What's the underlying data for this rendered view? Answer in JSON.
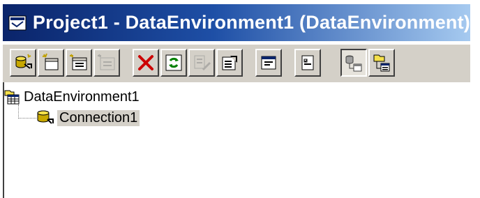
{
  "window": {
    "title": "Project1 - DataEnvironment1 (DataEnvironment)",
    "title_icon": "data-environment-window-icon"
  },
  "toolbar": {
    "buttons": [
      {
        "icon": "add-connection-icon",
        "state": "enabled"
      },
      {
        "icon": "add-command-icon",
        "state": "enabled"
      },
      {
        "icon": "add-child-command-icon",
        "state": "enabled"
      },
      {
        "icon": "insert-stored-procedures-icon",
        "state": "disabled"
      },
      {
        "icon": "delete-icon",
        "state": "enabled"
      },
      {
        "icon": "refresh-icon",
        "state": "enabled"
      },
      {
        "icon": "design-icon",
        "state": "disabled"
      },
      {
        "icon": "properties-icon",
        "state": "enabled"
      },
      {
        "icon": "view-code-icon",
        "state": "enabled"
      },
      {
        "icon": "options-icon",
        "state": "enabled"
      },
      {
        "icon": "arrange-by-connections-icon",
        "state": "pressed"
      },
      {
        "icon": "arrange-by-objects-icon",
        "state": "enabled"
      }
    ]
  },
  "tree": {
    "root": {
      "label": "DataEnvironment1",
      "icon": "data-environment-icon"
    },
    "children": [
      {
        "label": "Connection1",
        "icon": "connection-icon",
        "selected": true
      }
    ]
  },
  "colors": {
    "titlebar_start": "#0a246a",
    "titlebar_end": "#a6caf0",
    "toolbar_bg": "#d4d0c8",
    "delete_red": "#cc0000",
    "refresh_green": "#008000"
  }
}
